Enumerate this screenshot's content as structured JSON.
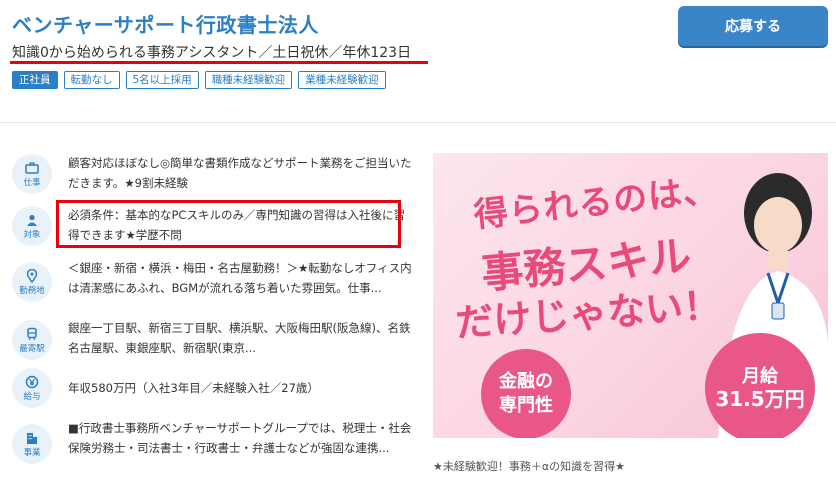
{
  "header": {
    "company": "ベンチャーサポート行政書士法人",
    "job_title": "知識0から始められる事務アシスタント／土日祝休／年休123日",
    "apply_label": "応募する",
    "tags": [
      "正社員",
      "転勤なし",
      "5名以上採用",
      "職種未経験歓迎",
      "業種未経験歓迎"
    ]
  },
  "details": [
    {
      "icon": "briefcase-icon",
      "label": "仕事",
      "text": "顧客対応ほぼなし◎簡単な書類作成などサポート業務をご担当いただきます。★9割未経験"
    },
    {
      "icon": "person-icon",
      "label": "対象",
      "text": "必須条件：基本的なPCスキルのみ／専門知識の習得は入社後に習得できます★学歴不問"
    },
    {
      "icon": "location-pin-icon",
      "label": "勤務地",
      "text": "＜銀座・新宿・横浜・梅田・名古屋勤務！＞★転勤なしオフィス内は清潔感にあふれ、BGMが流れる落ち着いた雰囲気。仕事..."
    },
    {
      "icon": "train-icon",
      "label": "最寄駅",
      "text": "銀座一丁目駅、新宿三丁目駅、横浜駅、大阪梅田駅(阪急線)、名鉄名古屋駅、東銀座駅、新宿駅(東京..."
    },
    {
      "icon": "yen-coin-icon",
      "label": "給与",
      "text": "年収580万円（入社3年目／未経験入社／27歳）"
    },
    {
      "icon": "building-icon",
      "label": "事業",
      "text": "■行政書士事務所ベンチャーサポートグループでは、税理士・社会保険労務士・司法書士・行政書士・弁護士などが強固な連携..."
    }
  ],
  "banner": {
    "line1": "得られるのは、",
    "line2": "事務スキル",
    "line3": "だけじゃない！",
    "badge_left_1": "金融の",
    "badge_left_2": "専門性",
    "badge_right_1": "月給",
    "badge_right_2": "31.5万円"
  },
  "caption": "★未経験歓迎！事務＋αの知識を習得★",
  "colors": {
    "accent": "#2a7fc6",
    "highlight": "#e60012",
    "banner_pink": "#e84a7a"
  }
}
